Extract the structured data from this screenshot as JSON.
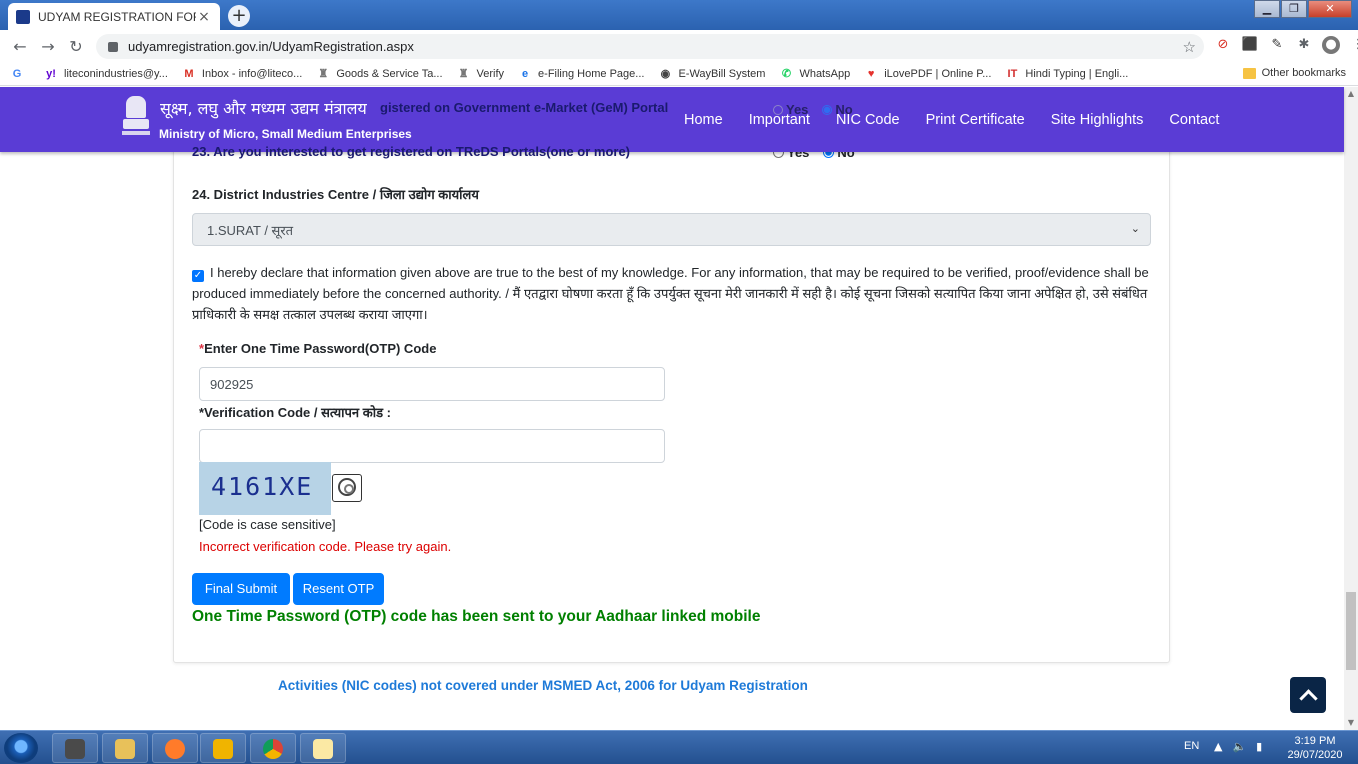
{
  "browser": {
    "tab_title": "UDYAM REGISTRATION FORM - Fo",
    "tab_close": "×",
    "new_tab": "+",
    "url": "udyamregistration.gov.in/UdyamRegistration.aspx",
    "bookmarks": [
      {
        "icon": "yahoo-mail-icon",
        "label": "liteconindustries@y...",
        "color": "#5f01d1",
        "glyph": "y!"
      },
      {
        "icon": "gmail-icon",
        "label": "Inbox - info@liteco...",
        "color": "#d93025",
        "glyph": "M"
      },
      {
        "icon": "gst-icon",
        "label": "Goods & Service Ta...",
        "color": "#777777",
        "glyph": "♜"
      },
      {
        "icon": "verify-icon",
        "label": "Verify",
        "color": "#777777",
        "glyph": "♜"
      },
      {
        "icon": "edge-icon",
        "label": "e-Filing Home Page...",
        "color": "#1a73e8",
        "glyph": "e"
      },
      {
        "icon": "globe-icon",
        "label": "E-WayBill System",
        "color": "#444444",
        "glyph": "◉"
      },
      {
        "icon": "whatsapp-icon",
        "label": "WhatsApp",
        "color": "#25d366",
        "glyph": "✆"
      },
      {
        "icon": "ilovepdf-icon",
        "label": "iLovePDF | Online P...",
        "color": "#e5322d",
        "glyph": "♥"
      },
      {
        "icon": "hindi-typing-icon",
        "label": "Hindi Typing | Engli...",
        "color": "#d32f2f",
        "glyph": "IT"
      }
    ],
    "other_bookmarks": "Other bookmarks"
  },
  "header": {
    "brand_hindi": "सूक्ष्म, लघु और मध्यम उद्यम मंत्रालय",
    "brand_english": "Ministry of Micro, Small Medium Enterprises",
    "nav": [
      "Home",
      "Important",
      "NIC Code",
      "Print Certificate",
      "Site Highlights",
      "Contact"
    ]
  },
  "form": {
    "q22_partial": "gistered on Government e-Market (GeM) Portal",
    "q23": "23. Are you interested to get registered on TReDS Portals(one or more)",
    "yes": "Yes",
    "no": "No",
    "q22_selected": "No",
    "q23_selected": "No",
    "dic_label": "24. District Industries Centre / जिला उद्योग कार्यालय",
    "dic_value": "1.SURAT / सूरत",
    "declaration_checked": true,
    "declaration": "I hereby declare that information given above are true to the best of my knowledge. For any information, that may be required to be verified, proof/evidence shall be produced immediately before the concerned authority. / मैं एतद्वारा घोषणा करता हूँ कि उपर्युक्त सूचना मेरी जानकारी में सही है। कोई सूचना जिसको सत्यापित किया जाना अपेक्षित हो, उसे संबंधित प्राधिकारी के समक्ष तत्काल उपलब्ध कराया जाएगा।",
    "otp_label": "Enter One Time Password(OTP) Code",
    "otp_value": "902925",
    "verification_label": "*Verification Code / सत्यापन कोड :",
    "verification_value": "",
    "captcha": "4161XE",
    "case_note": "[Code is case sensitive]",
    "error": "Incorrect verification code. Please try again.",
    "submit_label": "Final Submit",
    "resend_label": "Resent OTP",
    "otp_sent": "One Time Password (OTP) code has been sent to your Aadhaar linked mobile"
  },
  "footer_link": "Activities (NIC codes) not covered under MSMED Act, 2006 for Udyam Registration",
  "taskbar": {
    "lang": "EN",
    "time": "3:19 PM",
    "date": "29/07/2020"
  }
}
